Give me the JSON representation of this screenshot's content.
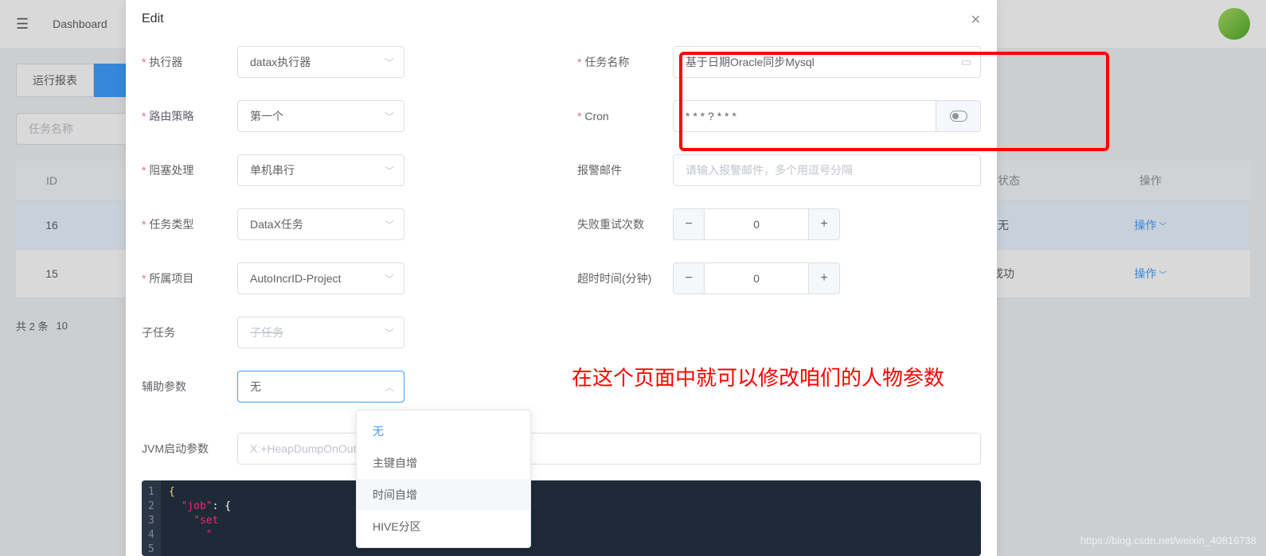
{
  "header": {
    "dashboard": "Dashboard"
  },
  "bg": {
    "tabs": [
      "运行报表"
    ],
    "search_placeholder": "任务名称",
    "columns": {
      "id": "ID",
      "status": "行状态",
      "op": "操作"
    },
    "rows": [
      {
        "id": "16",
        "status": "无",
        "op": "操作"
      },
      {
        "id": "15",
        "status": "成功",
        "op": "操作"
      }
    ],
    "pagination_total": "共 2 条",
    "pagination_size_prefix": "10"
  },
  "modal": {
    "title": "Edit",
    "left": {
      "executor": {
        "label": "执行器",
        "value": "datax执行器"
      },
      "route": {
        "label": "路由策略",
        "value": "第一个"
      },
      "block": {
        "label": "阻塞处理",
        "value": "单机串行"
      },
      "task_type": {
        "label": "任务类型",
        "value": "DataX任务"
      },
      "project": {
        "label": "所属项目",
        "value": "AutoIncrID-Project"
      },
      "subtask": {
        "label": "子任务",
        "placeholder": "子任务"
      },
      "aux": {
        "label": "辅助参数",
        "value": "无"
      }
    },
    "right": {
      "task_name": {
        "label": "任务名称",
        "value": "基于日期Oracle同步Mysql"
      },
      "cron": {
        "label": "Cron",
        "value": "* * * ? * * *"
      },
      "alarm": {
        "label": "报警邮件",
        "placeholder": "请输入报警邮件，多个用逗号分隔"
      },
      "retry": {
        "label": "失败重试次数",
        "value": "0"
      },
      "timeout": {
        "label": "超时时间(分钟)",
        "value": "0"
      }
    },
    "jvm": {
      "label": "JVM启动参数",
      "placeholder": "X:+HeapDumpOnOutOfMemoryError"
    },
    "dropdown": {
      "options": [
        "无",
        "主键自增",
        "时间自增",
        "HIVE分区"
      ]
    },
    "code": {
      "gutter": [
        "1",
        "2",
        "3",
        "4",
        "5"
      ],
      "l1_brace": "{",
      "l2_key": "\"job\"",
      "l2_rest": ": {",
      "l3_key": "\"set",
      "l4_key": "\""
    }
  },
  "annotation": "在这个页面中就可以修改咱们的人物参数",
  "watermark": "https://blog.csdn.net/weixin_40816738"
}
